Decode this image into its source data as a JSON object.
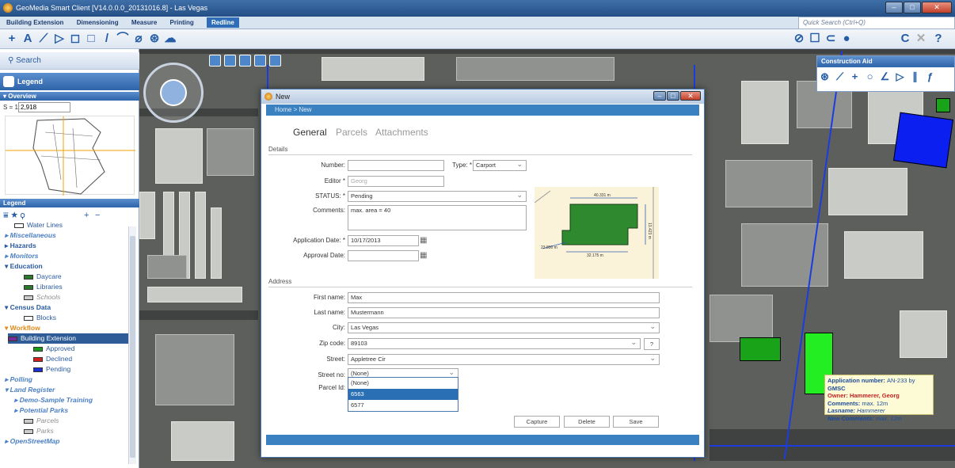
{
  "app": {
    "title": "GeoMedia Smart Client [V14.0.0.0_20131016.8] - Las Vegas",
    "quick_search_placeholder": "Quick Search (Ctrl+Q)"
  },
  "ribbon": {
    "tabs": [
      "Building Extension",
      "Dimensioning",
      "Measure",
      "Printing",
      "Redline"
    ],
    "active_tab": "Redline"
  },
  "left_panel": {
    "search": "Search",
    "legend_button": "Legend",
    "overview_header": "▾ Overview",
    "scale_label": "S = 1:",
    "scale_value": "2,918",
    "legend_header": "Legend",
    "items": [
      {
        "label": "Water Lines",
        "style": "layer",
        "indent": 1
      },
      {
        "label": "▸ Miscellaneous",
        "style": "group-i",
        "indent": 0
      },
      {
        "label": "▸ Hazards",
        "style": "group",
        "indent": 0
      },
      {
        "label": "▸ Monitors",
        "style": "group-i",
        "indent": 0
      },
      {
        "label": "▾ Education",
        "style": "group",
        "indent": 0
      },
      {
        "label": "Daycare",
        "style": "layer",
        "indent": 2
      },
      {
        "label": "Libraries",
        "style": "layer",
        "indent": 2
      },
      {
        "label": "Schools",
        "style": "gray",
        "indent": 2
      },
      {
        "label": "▾ Census Data",
        "style": "group",
        "indent": 0
      },
      {
        "label": "Blocks",
        "style": "layer",
        "indent": 2
      },
      {
        "label": "▾ Workflow",
        "style": "workflow",
        "indent": 0
      },
      {
        "label": "Building Extension",
        "style": "selected",
        "indent": 1
      },
      {
        "label": "Approved",
        "style": "layer",
        "indent": 3
      },
      {
        "label": "Declined",
        "style": "layer",
        "indent": 3
      },
      {
        "label": "Pending",
        "style": "layer",
        "indent": 3
      },
      {
        "label": "▸ Polling",
        "style": "group-i",
        "indent": 0
      },
      {
        "label": "▾ Land Register",
        "style": "group-i",
        "indent": 0
      },
      {
        "label": "▸ Demo-Sample Training",
        "style": "group-i",
        "indent": 1
      },
      {
        "label": "▸ Potential Parks",
        "style": "group-i",
        "indent": 1
      },
      {
        "label": "Parcels",
        "style": "gray",
        "indent": 2
      },
      {
        "label": "Parks",
        "style": "gray",
        "indent": 2
      },
      {
        "label": "▸ OpenStreetMap",
        "style": "group-i",
        "indent": 0
      }
    ]
  },
  "dialog": {
    "title": "New",
    "breadcrumb": "Home > New",
    "tabs": [
      "General",
      "Parcels",
      "Attachments"
    ],
    "details_header": "Details",
    "address_header": "Address",
    "fields": {
      "number": {
        "label": "Number:",
        "value": ""
      },
      "type": {
        "label": "Type: *",
        "value": "Carport"
      },
      "editor": {
        "label": "Editor *",
        "value": "Georg"
      },
      "status": {
        "label": "STATUS: *",
        "value": "Pending"
      },
      "comments": {
        "label": "Comments:",
        "value": "max. area = 40"
      },
      "app_date": {
        "label": "Application Date: *",
        "value": "10/17/2013"
      },
      "approval_date": {
        "label": "Approval Date:",
        "value": ""
      },
      "first_name": {
        "label": "First name:",
        "value": "Max"
      },
      "last_name": {
        "label": "Last name:",
        "value": "Mustermann"
      },
      "city": {
        "label": "City:",
        "value": "Las Vegas"
      },
      "zip": {
        "label": "Zip code:",
        "value": "89103"
      },
      "street": {
        "label": "Street:",
        "value": "Appletree Cir"
      },
      "street_no": {
        "label": "Street no:",
        "value": "(None)"
      },
      "parcel_id": {
        "label": "Parcel Id:"
      }
    },
    "parcel_options": [
      "(None)",
      "6563",
      "6577"
    ],
    "parcel_selected": "6563",
    "help": "?",
    "buttons": {
      "capture": "Capture",
      "delete": "Delete",
      "save": "Save"
    },
    "drawing_labels": [
      "40.331 m",
      "13.423 m",
      "32.175 m",
      "23.800 m"
    ]
  },
  "tooltip": {
    "app_number_label": "Application number:",
    "app_number": "AN-233",
    "by": "by",
    "by_value": "GMSC",
    "owner_label": "Owner:",
    "owner": "Hammerer, Georg",
    "comments_label": "Comments:",
    "comments": "max. 12m",
    "lastname_label": "Lasname:",
    "lastname": "Hammerer",
    "newcomments_label": "New Comments:",
    "newcomments": "max. 12m"
  },
  "construction_aid": {
    "title": "Construction Aid"
  },
  "colors": {
    "approved": "#1a9b1a",
    "declined": "#d61f1f",
    "pending": "#1b2fd6",
    "accent": "#2e64a9"
  }
}
